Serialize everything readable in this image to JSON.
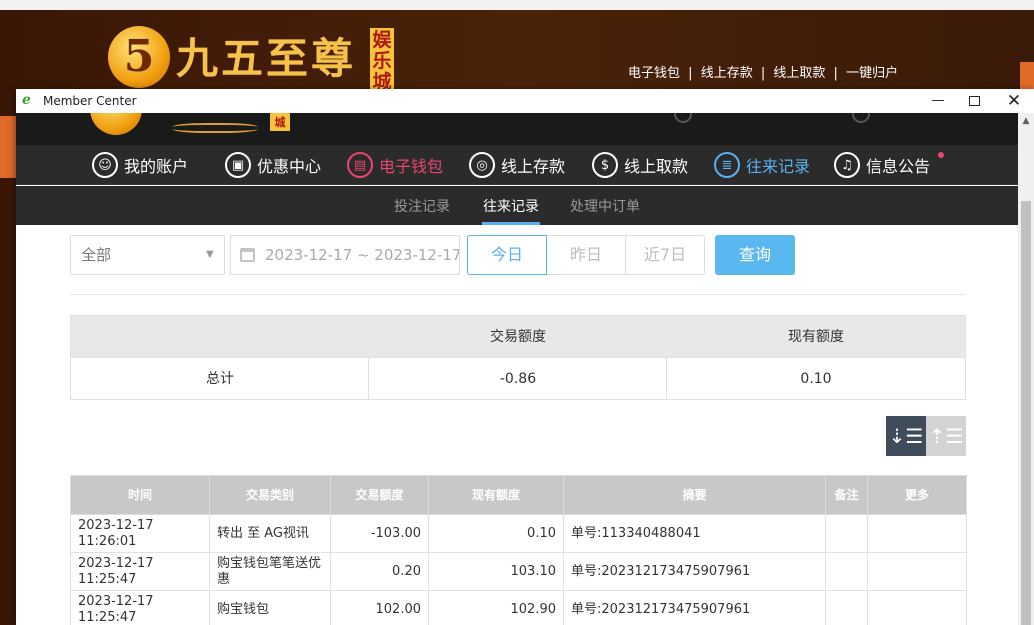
{
  "background": {
    "logo_digit": "5",
    "logo_text": "九五至尊",
    "logo_badge": "娱乐城",
    "top_links": [
      "电子钱包",
      "|",
      "线上存款",
      "|",
      "线上取款",
      "|",
      "一键归户"
    ]
  },
  "window": {
    "title": "Member Center",
    "minimize": "—",
    "close": "✕",
    "app_icon": "ie-icon"
  },
  "header": {
    "logo_badge": "城"
  },
  "nav": {
    "items": [
      {
        "label": "我的账户",
        "icon": "user-icon",
        "glyph": "☺"
      },
      {
        "label": "优惠中心",
        "icon": "gift-icon",
        "glyph": "▣"
      },
      {
        "label": "电子钱包",
        "icon": "wallet-icon",
        "glyph": "▤"
      },
      {
        "label": "线上存款",
        "icon": "deposit-icon",
        "glyph": "◎"
      },
      {
        "label": "线上取款",
        "icon": "withdraw-icon",
        "glyph": "$"
      },
      {
        "label": "往来记录",
        "icon": "records-icon",
        "glyph": "≣"
      },
      {
        "label": "信息公告",
        "icon": "bell-icon",
        "glyph": "♫"
      }
    ],
    "active_wallet_color": "#e8456f",
    "active_color": "#5ab1f0"
  },
  "subnav": {
    "items": [
      "投注记录",
      "往来记录",
      "处理中订单"
    ],
    "active": "往来记录"
  },
  "filters": {
    "type_select": "全部",
    "date_range": "2023-12-17 ~ 2023-12-17",
    "today": "今日",
    "yesterday": "昨日",
    "last7": "近7日",
    "query": "查询"
  },
  "summary": {
    "headers": [
      "交易额度",
      "现有额度"
    ],
    "label": "总计",
    "amount": "-0.86",
    "balance": "0.10"
  },
  "sort": {
    "desc_glyph": "⇣☰",
    "asc_glyph": "⇡☰"
  },
  "records": {
    "headers": [
      "时间",
      "交易类别",
      "交易额度",
      "现有额度",
      "摘要",
      "备注",
      "更多"
    ],
    "rows": [
      [
        "2023-12-17 11:26:01",
        "转出 至 AG视讯",
        "-103.00",
        "0.10",
        "单号:113340488041",
        "",
        ""
      ],
      [
        "2023-12-17 11:25:47",
        "购宝钱包笔笔送优惠",
        "0.20",
        "103.10",
        "单号:202312173475907961",
        "",
        ""
      ],
      [
        "2023-12-17 11:25:47",
        "购宝钱包",
        "102.00",
        "102.90",
        "单号:202312173475907961",
        "",
        ""
      ]
    ]
  }
}
